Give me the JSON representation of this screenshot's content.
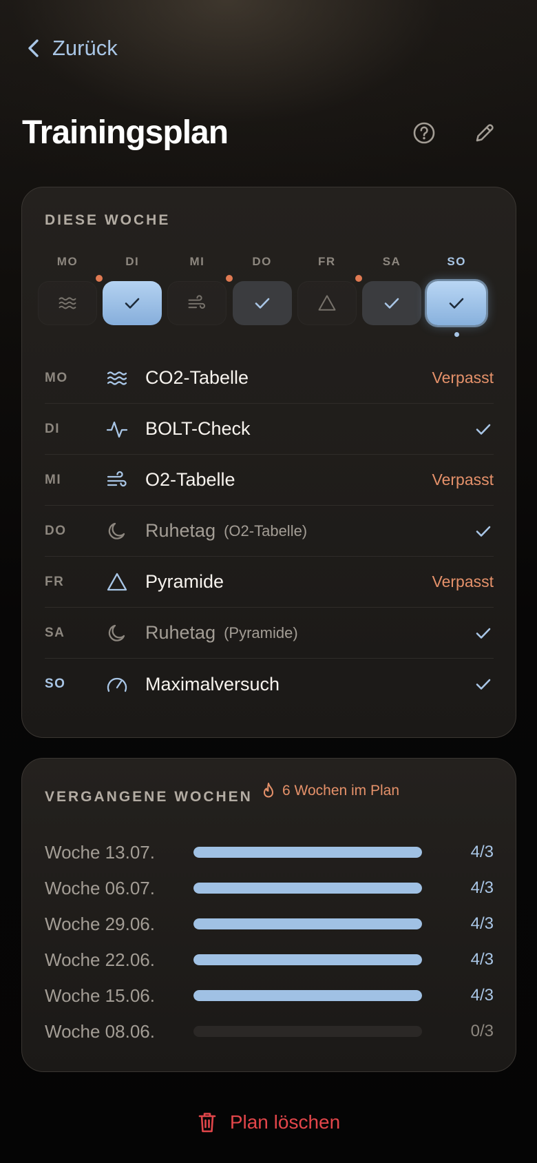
{
  "nav": {
    "back_label": "Zurück"
  },
  "header": {
    "title": "Trainingsplan",
    "icons": [
      "help-icon",
      "pencil-icon"
    ]
  },
  "colors": {
    "accent_blue": "#a9c6e6",
    "missed_orange": "#e5916a",
    "danger_red": "#e2464a"
  },
  "this_week": {
    "label": "DIESE WOCHE",
    "days": [
      {
        "day": "MO",
        "state": "missed",
        "icon": "waves-icon",
        "today": false
      },
      {
        "day": "DI",
        "state": "done",
        "icon": "check-icon",
        "today": false
      },
      {
        "day": "MI",
        "state": "missed",
        "icon": "wind-icon",
        "today": false
      },
      {
        "day": "DO",
        "state": "rest-done",
        "icon": "check-icon",
        "today": false
      },
      {
        "day": "FR",
        "state": "missed",
        "icon": "triangle-icon",
        "today": false
      },
      {
        "day": "SA",
        "state": "rest-done",
        "icon": "check-icon",
        "today": false
      },
      {
        "day": "SO",
        "state": "done",
        "icon": "check-icon",
        "today": true
      }
    ],
    "plan": [
      {
        "day": "MO",
        "icon": "waves-icon",
        "name": "CO2-Tabelle",
        "sub": "",
        "status": "Verpasst",
        "done": false,
        "rest": false,
        "today": false
      },
      {
        "day": "DI",
        "icon": "pulse-icon",
        "name": "BOLT-Check",
        "sub": "",
        "status": "",
        "done": true,
        "rest": false,
        "today": false
      },
      {
        "day": "MI",
        "icon": "wind-icon",
        "name": "O2-Tabelle",
        "sub": "",
        "status": "Verpasst",
        "done": false,
        "rest": false,
        "today": false
      },
      {
        "day": "DO",
        "icon": "moon-icon",
        "name": "Ruhetag",
        "sub": "(O2-Tabelle)",
        "status": "",
        "done": true,
        "rest": true,
        "today": false
      },
      {
        "day": "FR",
        "icon": "triangle-icon",
        "name": "Pyramide",
        "sub": "",
        "status": "Verpasst",
        "done": false,
        "rest": false,
        "today": false
      },
      {
        "day": "SA",
        "icon": "moon-icon",
        "name": "Ruhetag",
        "sub": "(Pyramide)",
        "status": "",
        "done": true,
        "rest": true,
        "today": false
      },
      {
        "day": "SO",
        "icon": "gauge-icon",
        "name": "Maximalversuch",
        "sub": "",
        "status": "",
        "done": true,
        "rest": false,
        "today": true
      }
    ]
  },
  "past_weeks": {
    "label": "VERGANGENE WOCHEN",
    "streak_label": "6 Wochen im Plan",
    "weeks": [
      {
        "label": "Woche 13.07.",
        "value": "4/3",
        "fill": 1.0
      },
      {
        "label": "Woche 06.07.",
        "value": "4/3",
        "fill": 1.0
      },
      {
        "label": "Woche 29.06.",
        "value": "4/3",
        "fill": 1.0
      },
      {
        "label": "Woche 22.06.",
        "value": "4/3",
        "fill": 1.0
      },
      {
        "label": "Woche 15.06.",
        "value": "4/3",
        "fill": 1.0
      },
      {
        "label": "Woche 08.06.",
        "value": "0/3",
        "fill": 0.0
      }
    ]
  },
  "footer": {
    "delete_label": "Plan löschen"
  }
}
